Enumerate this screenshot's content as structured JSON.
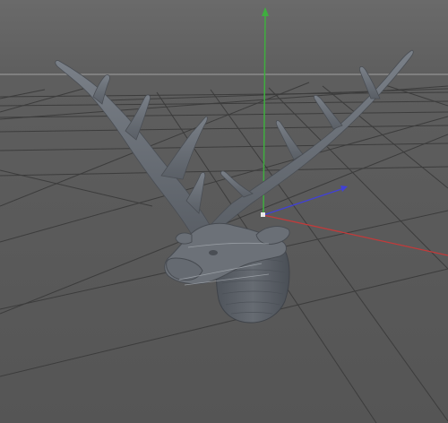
{
  "viewport": {
    "view": "perspective",
    "background_color": "#5b5b5b",
    "grid_color": "#3e3e3e",
    "horizon_color": "#8a8a8a",
    "grid": true
  },
  "axes": {
    "x_color": "#c33a3a",
    "y_color": "#3fae3f",
    "z_color": "#4040d8"
  },
  "model": {
    "name": "deer-head-trophy",
    "color": "#6a6f76"
  }
}
